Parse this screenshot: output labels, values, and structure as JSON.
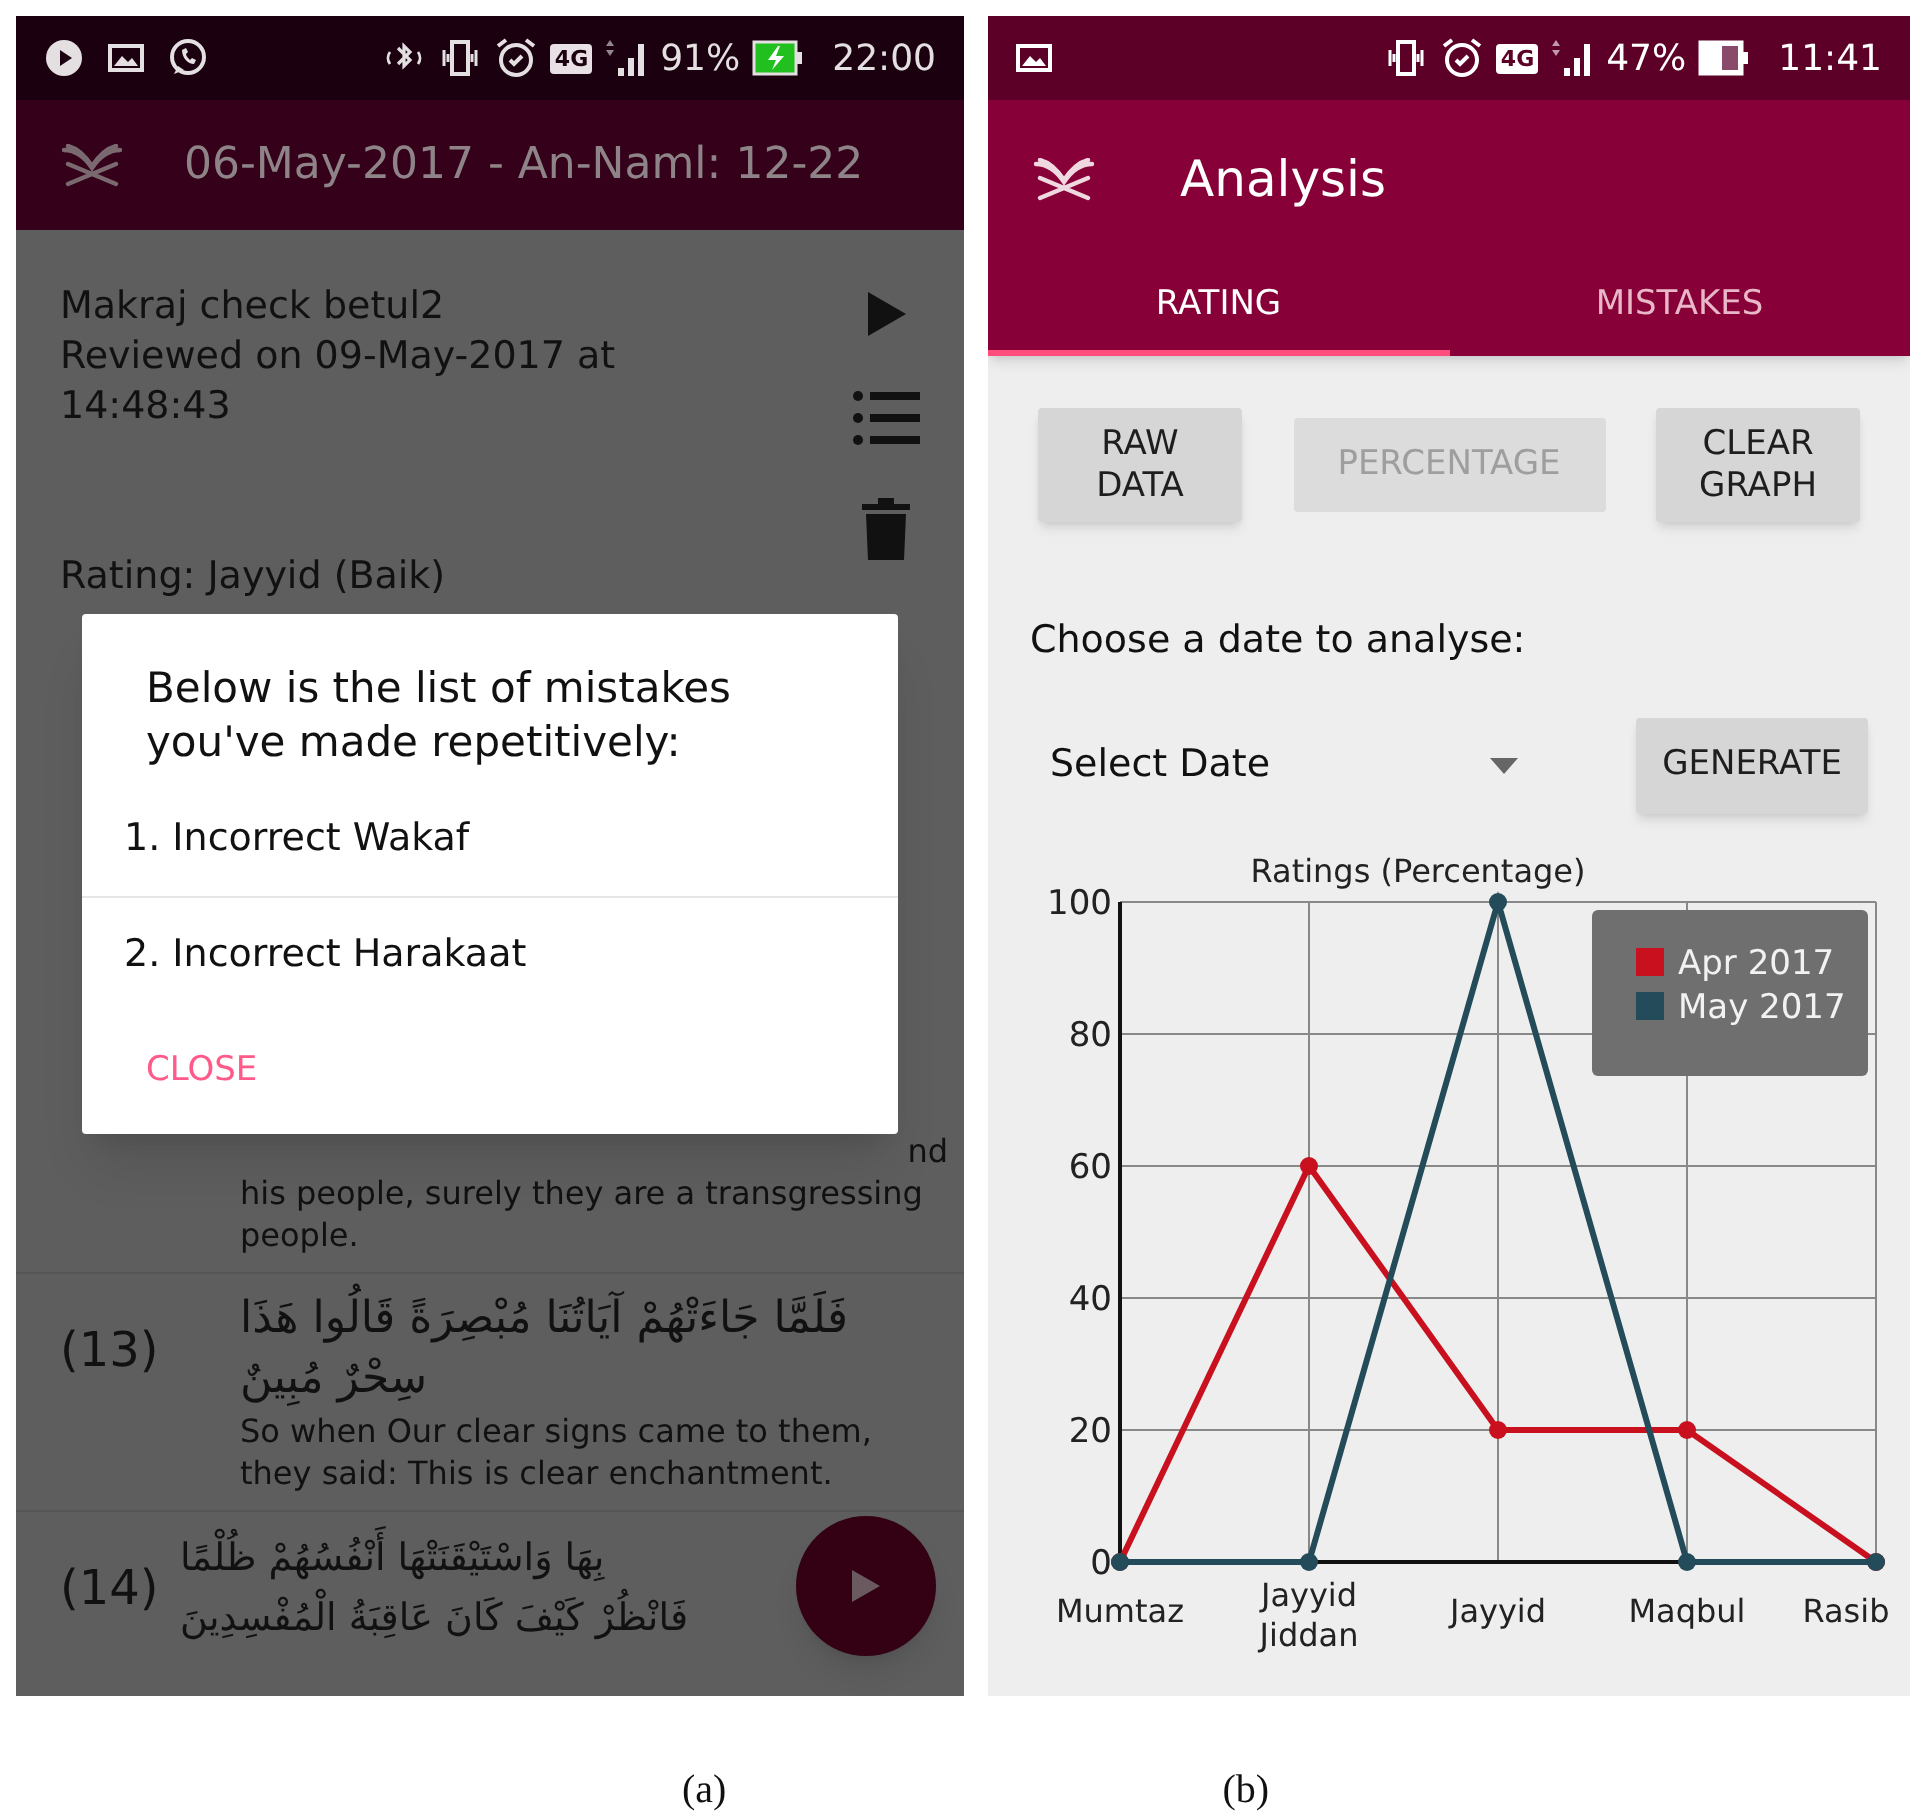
{
  "screen_a": {
    "status_bar": {
      "network": "4G",
      "battery": "91%",
      "charging": true,
      "time": "22:00"
    },
    "app_bar": {
      "title": "06-May-2017 - An-Naml: 12-22"
    },
    "recording": {
      "name": "Makraj check betul2",
      "reviewed": "Reviewed on 09-May-2017 at 14:48:43",
      "rating": "Rating: Jayyid (Baik)"
    },
    "verses": [
      {
        "fragment": "nd",
        "translation": "his people, surely they are a transgressing people."
      },
      {
        "number": "(13)",
        "arabic": [
          "فَلَمَّا جَاءَتْهُمْ آيَاتُنَا مُبْصِرَةً قَالُوا هَذَا",
          "سِحْرٌ مُبِينٌ"
        ],
        "translation": "So when Our clear signs came to them, they said: This is clear enchantment."
      },
      {
        "number": "(14)",
        "arabic": [
          "بِهَا وَاسْتَيْقَنَتْهَا أَنْفُسُهُمْ ظُلْمًا",
          "فَانْظُرْ كَيْفَ كَانَ عَاقِبَةُ الْمُفْسِدِينَ"
        ]
      }
    ],
    "dialog": {
      "message": "Below is the list of mistakes you've made repetitively:",
      "items": [
        "1. Incorrect Wakaf",
        "2. Incorrect Harakaat"
      ],
      "button": "CLOSE"
    }
  },
  "screen_b": {
    "status_bar": {
      "network": "4G",
      "battery": "47%",
      "charging": false,
      "time": "11:41"
    },
    "app_bar": {
      "title": "Analysis"
    },
    "tabs": [
      {
        "label": "RATING",
        "selected": true
      },
      {
        "label": "MISTAKES",
        "selected": false
      }
    ],
    "mode_buttons": [
      {
        "label": "RAW DATA",
        "disabled": false
      },
      {
        "label": "PERCENTAGE",
        "disabled": true
      },
      {
        "label": "CLEAR GRAPH",
        "disabled": false
      }
    ],
    "prompt": "Choose a date to analyse:",
    "date_dropdown": {
      "value": "Select Date"
    },
    "generate_button": "GENERATE",
    "chart_data": {
      "type": "line",
      "title": "Ratings (Percentage)",
      "grid": true,
      "legend": true,
      "categories": [
        "Mumtaz",
        "Jayyid Jiddan",
        "Jayyid",
        "Maqbul",
        "Rasib"
      ],
      "ylim": [
        0,
        100
      ],
      "yticks": [
        0,
        20,
        40,
        60,
        80,
        100
      ],
      "series": [
        {
          "name": "Apr 2017",
          "color": "#c8101e",
          "marker": "circle",
          "values": [
            0,
            60,
            20,
            20,
            0
          ]
        },
        {
          "name": "May 2017",
          "color": "#234b59",
          "marker": "circle",
          "values": [
            0,
            0,
            100,
            0,
            0
          ]
        }
      ]
    }
  },
  "captions": [
    "(a)",
    "(b)"
  ]
}
